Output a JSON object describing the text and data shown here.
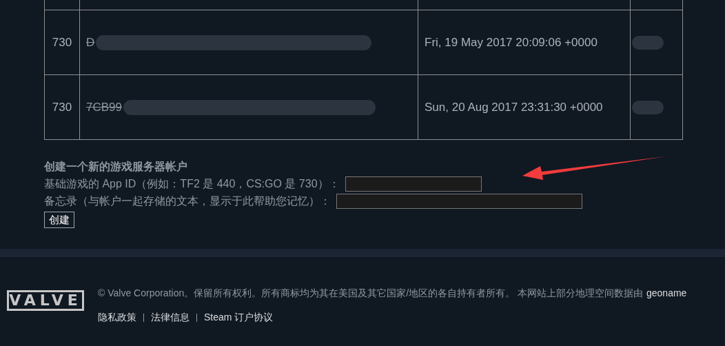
{
  "table": {
    "rows": [
      {
        "app_id": "730",
        "token": "D",
        "redacted": true,
        "date": "Fri, 19 May 2017 20:09:06 +0000"
      },
      {
        "app_id": "730",
        "token": "7CB99",
        "redacted": true,
        "date": "Sun, 20 Aug 2017 23:31:30 +0000"
      }
    ]
  },
  "create_form": {
    "title": "创建一个新的游戏服务器帐户",
    "fields": [
      {
        "label": "基础游戏的 App ID（例如：TF2 是 440，CS:GO 是 730）："
      },
      {
        "label": "备忘录（与帐户一起存储的文本，显示于此帮助您记忆）："
      }
    ],
    "button": "创建"
  },
  "footer": {
    "logo": "VALVE",
    "legal": "© Valve Corporation。保留所有权利。所有商标均为其在美国及其它国家/地区的各自持有者所有。 本网站上部分地理空间数据由",
    "link": "geoname",
    "links": [
      "隐私政策",
      "法律信息",
      "Steam 订户协议"
    ]
  }
}
